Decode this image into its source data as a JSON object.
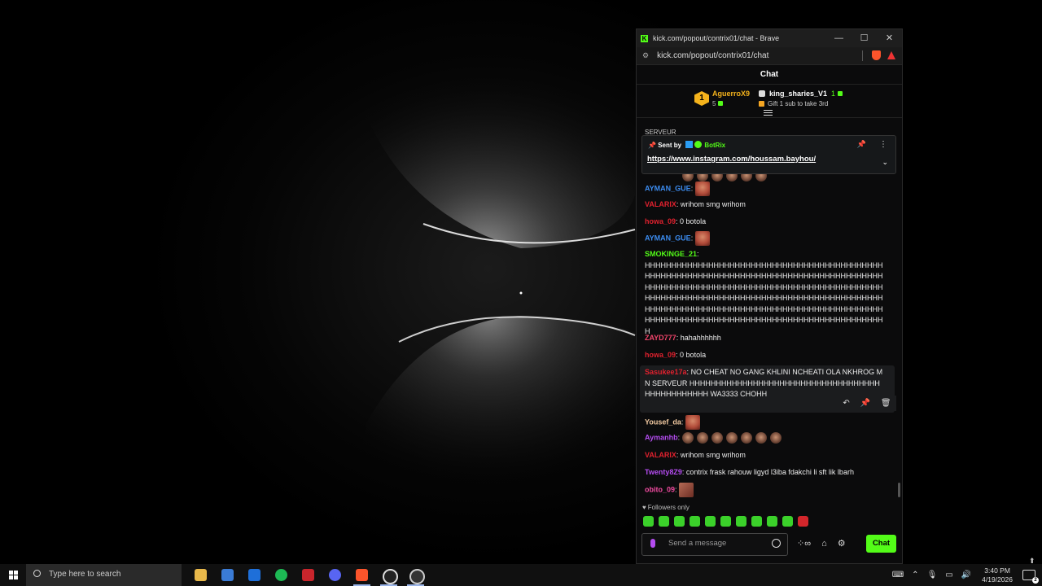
{
  "window": {
    "title": "kick.com/popout/contrix01/chat - Brave",
    "url": "kick.com/popout/contrix01/chat"
  },
  "chat": {
    "header": "Chat",
    "leaderboard": {
      "first": {
        "rank": "1",
        "name": "AguerroX9",
        "count": "5"
      },
      "second": {
        "name": "king_sharies_V1",
        "count": "1"
      },
      "gift_text": "Gift 1 sub to take 3rd"
    },
    "cut_label": "SERVEUR",
    "pinned": {
      "sent_by": "Sent by",
      "bot": "BotRix",
      "link": "https://www.instagram.com/houssam.bayhou/"
    },
    "messages": [
      {
        "user": "AYMAN_GUE",
        "color": "#3c8cf0",
        "text": ""
      },
      {
        "user": "VALARIX",
        "color": "#e0212e",
        "text": "wrihom smg wrihom"
      },
      {
        "user": "howa_09",
        "color": "#e0212e",
        "text": "0 botola"
      },
      {
        "user": "AYMAN_GUE",
        "color": "#3c8cf0",
        "text": ""
      },
      {
        "user": "SMOKINGE_21",
        "color": "#53fc18",
        "text": "HHHHHHHHHHHHHHHHHHHHHHHHHHHHHHHHHHHHHHHHHHHHHHHHHHHHHHHHHHHHHHHHHHHHHHHHHHHHHHHHHHHHHHHHHHHHHHHHHHHHHHHHHHHHHHHHHHHHHHHHHHHHHHHHHHHHHHHHHHHHHHHHHHHHHHHHHHHHHHHHHHHHHHHHHHHHHHHHHHHHHHHHHHHHHHHHHHHHHHHHHHHHHHHHHHHHHHHHHHHHHHHHHHHHHHHHHHHHHHHHHHHHHHHHHHHHHHHHHHHHHHHHHHHHHHH"
      },
      {
        "user": "ZAYD777",
        "color": "#f0446a",
        "text": "hahahhhhhh"
      },
      {
        "user": "howa_09",
        "color": "#e0212e",
        "text": "0 botola"
      },
      {
        "user": "Sasukee17a",
        "color": "#e0212e",
        "text": "NO CHEAT NO GANG KHLINI NCHEATI OLA NKHROG MN SERVEUR HHHHHHHHHHHHHHHHHHHHHHHHHHHHHHHHHHHHHHHHHHHHHHHH WA3333 CHOHH"
      },
      {
        "user": "Yousef_da",
        "color": "#f0c8a0",
        "text": ""
      },
      {
        "user": "Aymanhb",
        "color": "#b44cf0",
        "text": ""
      },
      {
        "user": "VALARIX",
        "color": "#e0212e",
        "text": "wrihom smg wrihom"
      },
      {
        "user": "Twenty8Z9",
        "color": "#b44cf0",
        "text": "contrix frask rahouw ligyd l3iba fdakchi li sft lik lbarh"
      },
      {
        "user": "obito_09",
        "color": "#f04ba0",
        "text": ""
      }
    ],
    "followers_only": "Followers only",
    "input_placeholder": "Send a message",
    "send_label": "Chat"
  },
  "taskbar": {
    "search_placeholder": "Type here to search",
    "time": "3:40 PM",
    "date": "4/19/2026",
    "notifications": "2"
  }
}
